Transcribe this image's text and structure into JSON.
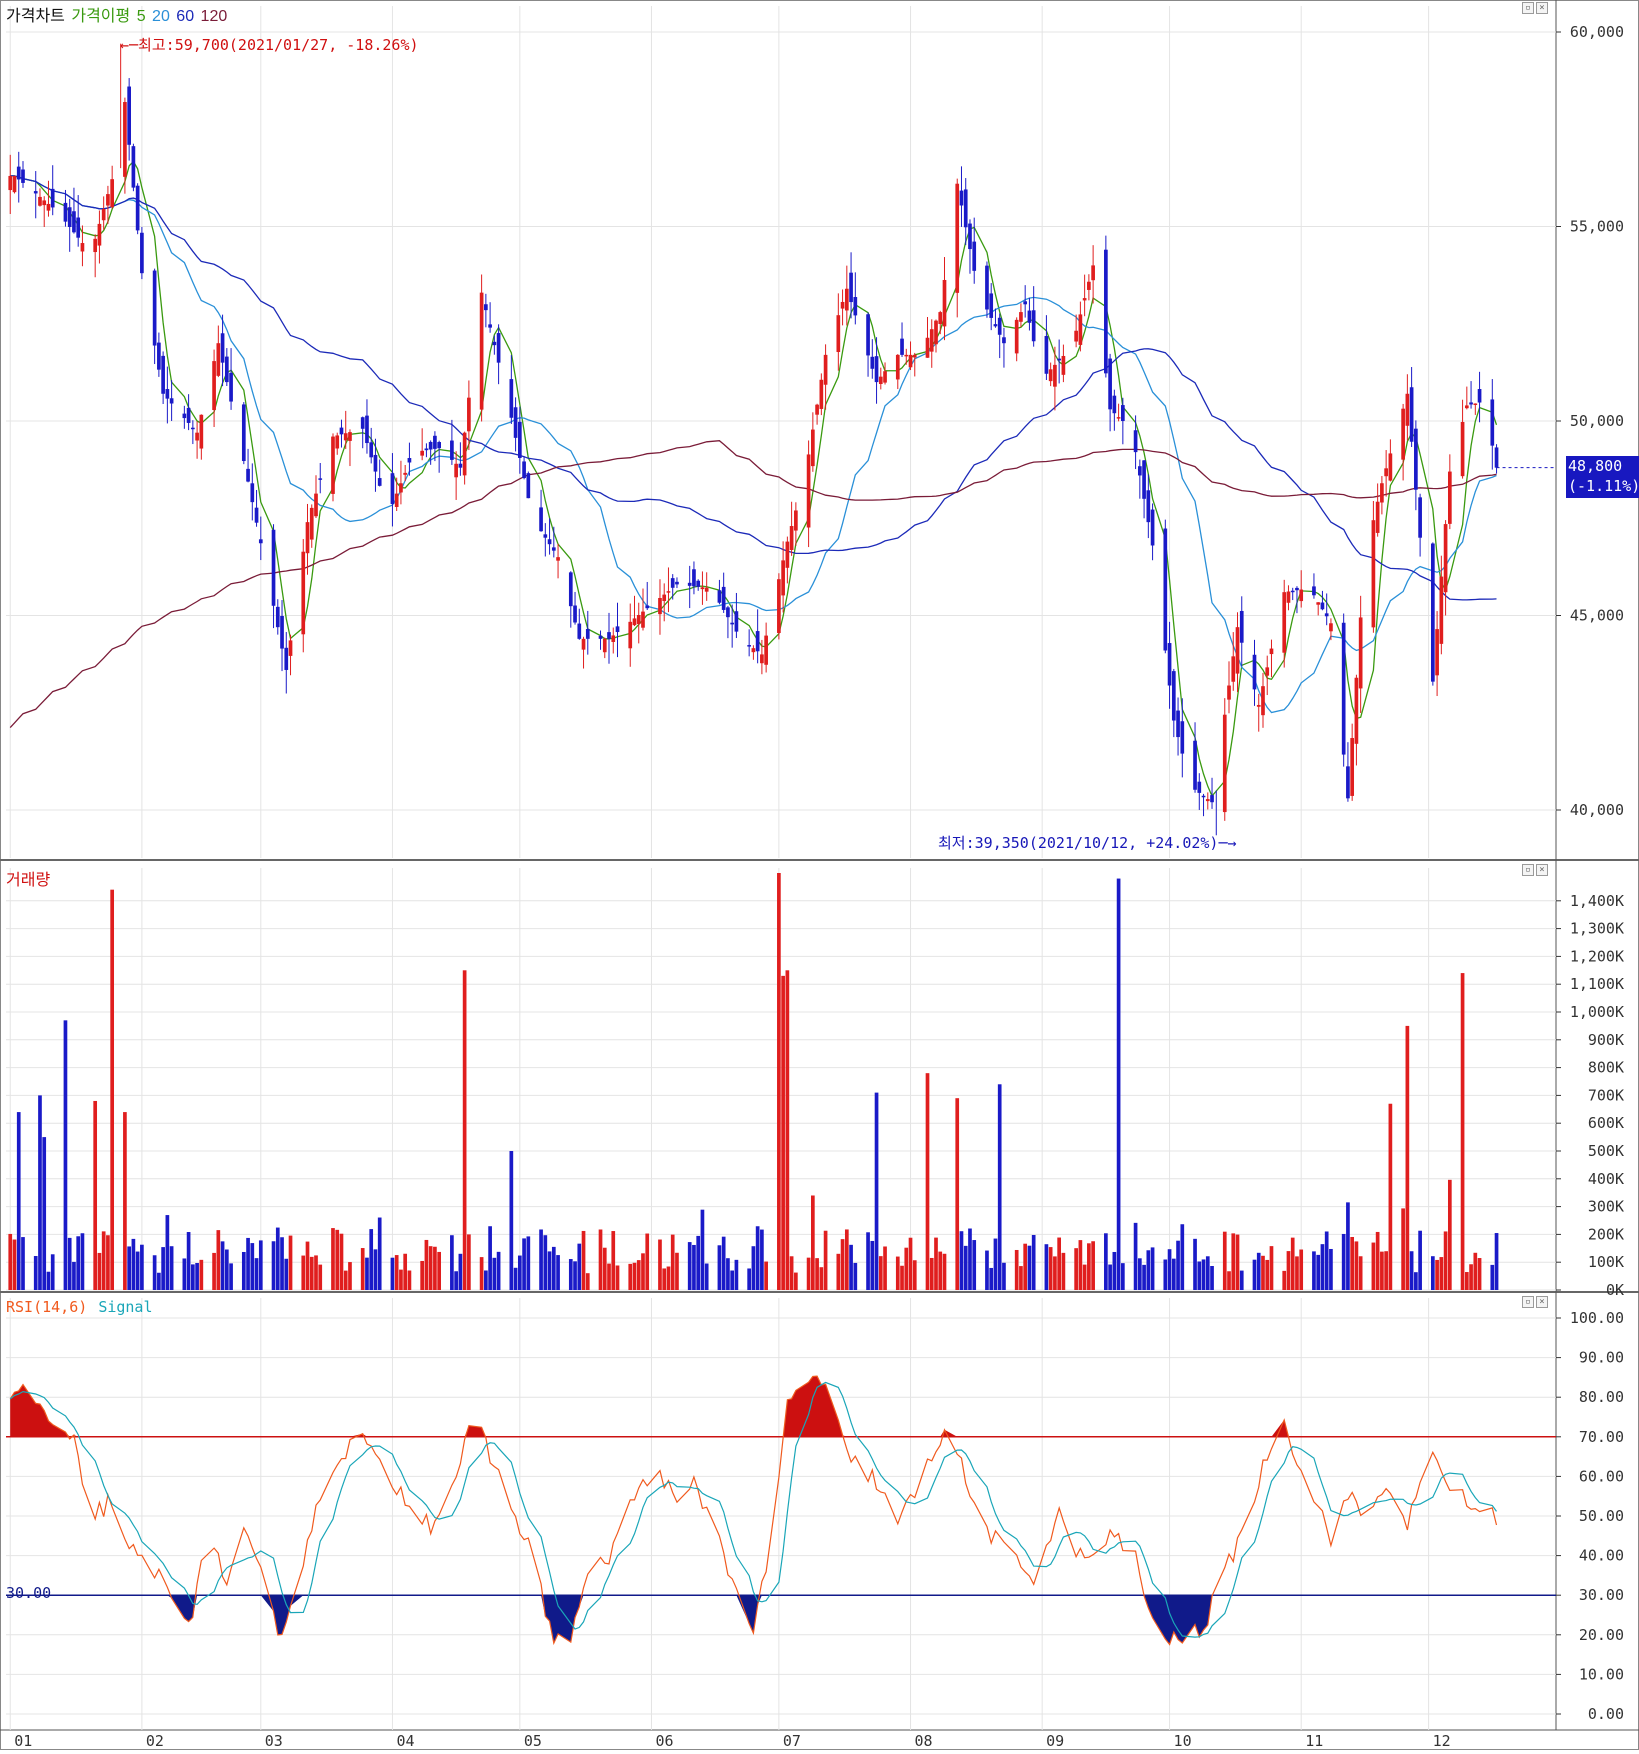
{
  "colors": {
    "up": "#e01e1e",
    "down": "#1a1ac8",
    "ma5": "#3a9a10",
    "ma20": "#2a90d8",
    "ma60": "#1c2ab8",
    "ma120": "#7a1c38",
    "grid": "#e4e4e4",
    "axis": "#333333",
    "rsi": "#f05a1e",
    "signal": "#1aa6b8",
    "rsi_hi": "#cc1010",
    "rsi_lo": "#101a8a",
    "price_tag": "#1818c0"
  },
  "legend": {
    "price": {
      "label": "가격차트",
      "ma_label": "가격이평",
      "ma5": "5",
      "ma20": "20",
      "ma60": "60",
      "ma120": "120"
    },
    "volume": {
      "label": "거래량"
    },
    "rsi": {
      "label": "RSI(14,6)",
      "signal": "Signal"
    }
  },
  "annotations": {
    "high": "←─최고:59,700(2021/01/27, -18.26%)",
    "low": "최저:39,350(2021/10/12, +24.02%)─→",
    "current_price": "48,800",
    "current_change": "(-1.11%)",
    "rsi_level": "30.00"
  },
  "chart_data": [
    {
      "type": "candlestick",
      "panel": "price",
      "ylim": [
        38700,
        61000
      ],
      "y_ticks": [
        "60,000",
        "55,000",
        "50,000",
        "45,000",
        "40,000"
      ],
      "y_tick_values": [
        60000,
        55000,
        50000,
        45000,
        40000
      ],
      "x_ticks": [
        "01",
        "02",
        "03",
        "04",
        "05",
        "06",
        "07",
        "08",
        "09",
        "10",
        "11",
        "12"
      ],
      "x_tick_days": [
        1,
        32,
        60,
        91,
        121,
        152,
        182,
        213,
        244,
        274,
        305,
        335
      ],
      "x_range_days": [
        0,
        365
      ],
      "anchors": [
        [
          2,
          56300
        ],
        [
          12,
          55400
        ],
        [
          20,
          54300
        ],
        [
          26,
          56600
        ],
        [
          28,
          58200
        ],
        [
          32,
          53800
        ],
        [
          37,
          50700
        ],
        [
          45,
          49700
        ],
        [
          50,
          52000
        ],
        [
          55,
          49500
        ],
        [
          62,
          45800
        ],
        [
          66,
          43600
        ],
        [
          71,
          47400
        ],
        [
          77,
          49600
        ],
        [
          84,
          49800
        ],
        [
          90,
          47600
        ],
        [
          96,
          49200
        ],
        [
          102,
          49300
        ],
        [
          107,
          48800
        ],
        [
          112,
          53300
        ],
        [
          118,
          50600
        ],
        [
          124,
          47500
        ],
        [
          130,
          46500
        ],
        [
          135,
          44400
        ],
        [
          142,
          44400
        ],
        [
          150,
          45100
        ],
        [
          158,
          45800
        ],
        [
          166,
          45700
        ],
        [
          173,
          44400
        ],
        [
          178,
          44000
        ],
        [
          184,
          46900
        ],
        [
          188,
          48500
        ],
        [
          193,
          51700
        ],
        [
          198,
          53400
        ],
        [
          205,
          51000
        ],
        [
          210,
          51700
        ],
        [
          215,
          51700
        ],
        [
          220,
          52800
        ],
        [
          224,
          56100
        ],
        [
          229,
          53300
        ],
        [
          235,
          52000
        ],
        [
          240,
          53000
        ],
        [
          244,
          51100
        ],
        [
          251,
          51900
        ],
        [
          256,
          54000
        ],
        [
          260,
          50300
        ],
        [
          265,
          49800
        ],
        [
          270,
          46800
        ],
        [
          275,
          42300
        ],
        [
          279,
          40600
        ],
        [
          284,
          40200
        ],
        [
          290,
          44700
        ],
        [
          295,
          42700
        ],
        [
          301,
          45600
        ],
        [
          307,
          45700
        ],
        [
          312,
          44800
        ],
        [
          316,
          40300
        ],
        [
          320,
          46500
        ],
        [
          324,
          48400
        ],
        [
          330,
          50700
        ],
        [
          336,
          43300
        ],
        [
          340,
          48700
        ],
        [
          344,
          50400
        ],
        [
          348,
          50500
        ],
        [
          351,
          48800
        ]
      ],
      "high_point": {
        "date": "2021/01/27",
        "value": 59700
      },
      "low_point": {
        "date": "2021/10/12",
        "value": 39350
      },
      "last": {
        "value": 48800,
        "change_pct": -1.11
      },
      "series": [
        {
          "name": "5"
        },
        {
          "name": "20"
        },
        {
          "name": "60"
        },
        {
          "name": "120"
        }
      ]
    },
    {
      "type": "bar",
      "panel": "volume",
      "ylim": [
        0,
        1500
      ],
      "unit": "K",
      "y_ticks": [
        "1,400K",
        "1,300K",
        "1,200K",
        "1,100K",
        "1,000K",
        "900K",
        "800K",
        "700K",
        "600K",
        "500K",
        "400K",
        "300K",
        "200K",
        "100K",
        "0K"
      ],
      "y_tick_values": [
        1400,
        1300,
        1200,
        1100,
        1000,
        900,
        800,
        700,
        600,
        500,
        400,
        300,
        200,
        100,
        0
      ],
      "spikes": [
        [
          4,
          640
        ],
        [
          9,
          700
        ],
        [
          10,
          550
        ],
        [
          14,
          970
        ],
        [
          22,
          680
        ],
        [
          26,
          1440
        ],
        [
          27,
          640
        ],
        [
          109,
          1150
        ],
        [
          120,
          500
        ],
        [
          183,
          1500
        ],
        [
          184,
          1130
        ],
        [
          185,
          1150
        ],
        [
          206,
          710
        ],
        [
          218,
          780
        ],
        [
          225,
          690
        ],
        [
          235,
          740
        ],
        [
          263,
          1480
        ],
        [
          327,
          670
        ],
        [
          331,
          950
        ],
        [
          342,
          980
        ],
        [
          343,
          1140
        ]
      ]
    },
    {
      "type": "line",
      "panel": "rsi",
      "ylim": [
        0,
        100
      ],
      "y_ticks": [
        "100.00",
        "90.00",
        "80.00",
        "70.00",
        "60.00",
        "50.00",
        "40.00",
        "30.00",
        "20.00",
        "10.00",
        "0.00"
      ],
      "y_tick_values": [
        100,
        90,
        80,
        70,
        60,
        50,
        40,
        30,
        20,
        10,
        0
      ],
      "levels": [
        70,
        30
      ],
      "anchors": [
        [
          0,
          80
        ],
        [
          3,
          82
        ],
        [
          8,
          78
        ],
        [
          12,
          70
        ],
        [
          16,
          68
        ],
        [
          20,
          50
        ],
        [
          24,
          53
        ],
        [
          28,
          42
        ],
        [
          34,
          38
        ],
        [
          40,
          28
        ],
        [
          44,
          25
        ],
        [
          48,
          48
        ],
        [
          52,
          32
        ],
        [
          56,
          45
        ],
        [
          60,
          35
        ],
        [
          64,
          20
        ],
        [
          68,
          30
        ],
        [
          72,
          48
        ],
        [
          78,
          65
        ],
        [
          84,
          70
        ],
        [
          88,
          62
        ],
        [
          94,
          55
        ],
        [
          100,
          48
        ],
        [
          106,
          60
        ],
        [
          110,
          75
        ],
        [
          114,
          65
        ],
        [
          118,
          55
        ],
        [
          124,
          40
        ],
        [
          128,
          22
        ],
        [
          132,
          15
        ],
        [
          136,
          32
        ],
        [
          142,
          40
        ],
        [
          148,
          55
        ],
        [
          154,
          62
        ],
        [
          158,
          52
        ],
        [
          162,
          58
        ],
        [
          168,
          45
        ],
        [
          172,
          30
        ],
        [
          176,
          22
        ],
        [
          180,
          40
        ],
        [
          184,
          78
        ],
        [
          190,
          86
        ],
        [
          194,
          80
        ],
        [
          198,
          65
        ],
        [
          204,
          60
        ],
        [
          210,
          48
        ],
        [
          216,
          60
        ],
        [
          222,
          75
        ],
        [
          226,
          58
        ],
        [
          230,
          48
        ],
        [
          236,
          40
        ],
        [
          242,
          35
        ],
        [
          248,
          50
        ],
        [
          254,
          38
        ],
        [
          260,
          45
        ],
        [
          266,
          40
        ],
        [
          270,
          22
        ],
        [
          276,
          18
        ],
        [
          282,
          22
        ],
        [
          288,
          38
        ],
        [
          294,
          55
        ],
        [
          300,
          76
        ],
        [
          304,
          65
        ],
        [
          308,
          55
        ],
        [
          312,
          45
        ],
        [
          316,
          55
        ],
        [
          320,
          50
        ],
        [
          326,
          58
        ],
        [
          330,
          48
        ],
        [
          336,
          65
        ],
        [
          340,
          58
        ],
        [
          345,
          52
        ],
        [
          351,
          50
        ]
      ]
    }
  ]
}
